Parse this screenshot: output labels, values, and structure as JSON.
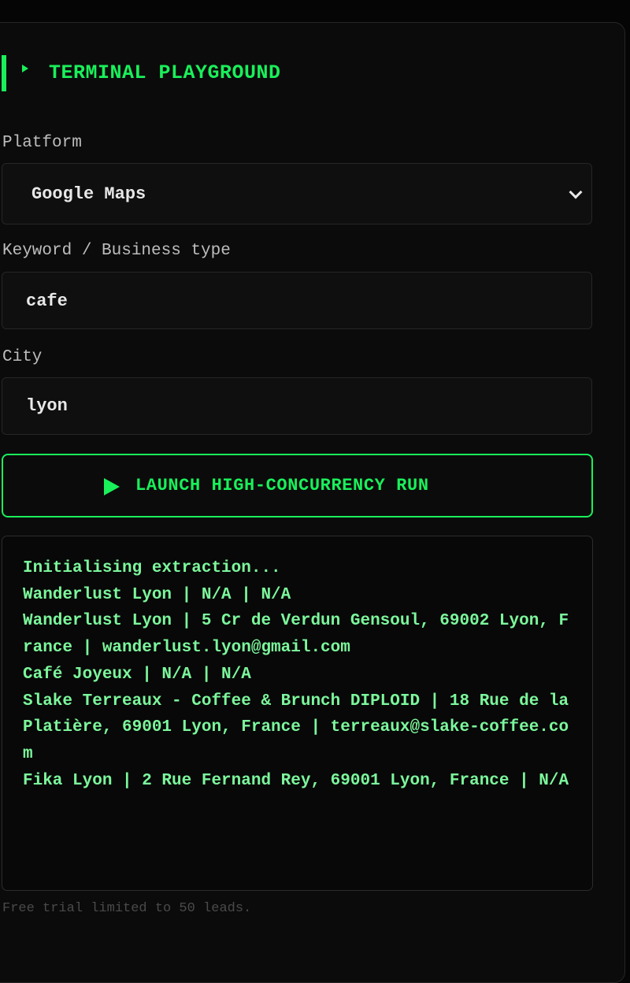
{
  "header": {
    "title": "TERMINAL PLAYGROUND"
  },
  "form": {
    "platform_label": "Platform",
    "platform_value": "Google Maps",
    "keyword_label": "Keyword / Business type",
    "keyword_value": "cafe",
    "city_label": "City",
    "city_value": "lyon"
  },
  "launch": {
    "label": "LAUNCH HIGH-CONCURRENCY RUN"
  },
  "console": {
    "lines": [
      "Initialising extraction...",
      "Wanderlust Lyon | N/A | N/A",
      "Wanderlust Lyon | 5 Cr de Verdun Gensoul, 69002 Lyon, France | wanderlust.lyon@gmail.com",
      "Café Joyeux | N/A | N/A",
      "Slake Terreaux - Coffee & Brunch DIPLOID | 18 Rue de la Platière, 69001 Lyon, France | terreaux@slake-coffee.com",
      "Fika Lyon | 2 Rue Fernand Rey, 69001 Lyon, France | N/A"
    ]
  },
  "footer": {
    "note": "Free trial limited to 50 leads."
  },
  "colors": {
    "accent": "#19f05a",
    "console_text": "#7cf79c",
    "background": "#0b0b0b"
  },
  "icons": {
    "header_marker": "caret-right-icon",
    "select_arrow": "chevron-down-icon",
    "launch": "play-icon"
  }
}
